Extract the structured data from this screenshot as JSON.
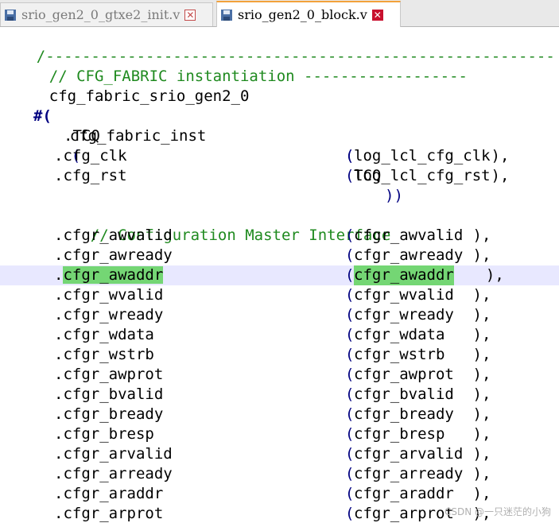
{
  "tabs": [
    {
      "label": "srio_gen2_0_gtxe2_init.v",
      "active": false,
      "icon": "save-file-icon"
    },
    {
      "label": "srio_gen2_0_block.v",
      "active": true,
      "icon": "save-file-icon"
    }
  ],
  "close_glyph": "✕",
  "code": {
    "separator": "/--------------------------------------------------------",
    "comment1": "// CFG_FABRIC instantiation ------------------",
    "module_name": "cfg_fabric_srio_gen2_0",
    "param_hash": "#(",
    "param_name": ".TCQ",
    "param_open": "(",
    "param_value": "TCQ",
    "param_close": "))",
    "inst_name": "cfg_fabric_inst",
    "open_paren": "(",
    "comment2": "// Configuration Master Interface",
    "ports_top": [
      {
        "port": ".cfg_clk",
        "signal": "log_lcl_cfg_clk",
        "end": "),"
      },
      {
        "port": ".cfg_rst",
        "signal": "log_lcl_cfg_rst",
        "end": "),"
      }
    ],
    "ports": [
      {
        "port": "cfgr_awvalid",
        "signal": "cfgr_awvalid ",
        "end": "),"
      },
      {
        "port": "cfgr_awready",
        "signal": "cfgr_awready ",
        "end": "),"
      },
      {
        "port": "cfgr_awaddr",
        "signal": "cfgr_awaddr",
        "end": "  ),"
      },
      {
        "port": "cfgr_wvalid",
        "signal": "cfgr_wvalid  ",
        "end": "),"
      },
      {
        "port": "cfgr_wready",
        "signal": "cfgr_wready  ",
        "end": "),"
      },
      {
        "port": "cfgr_wdata",
        "signal": "cfgr_wdata   ",
        "end": "),"
      },
      {
        "port": "cfgr_wstrb",
        "signal": "cfgr_wstrb   ",
        "end": "),"
      },
      {
        "port": "cfgr_awprot",
        "signal": "cfgr_awprot  ",
        "end": "),"
      },
      {
        "port": "cfgr_bvalid",
        "signal": "cfgr_bvalid  ",
        "end": "),"
      },
      {
        "port": "cfgr_bready",
        "signal": "cfgr_bready  ",
        "end": "),"
      },
      {
        "port": "cfgr_bresp",
        "signal": "cfgr_bresp   ",
        "end": "),"
      },
      {
        "port": "cfgr_arvalid",
        "signal": "cfgr_arvalid ",
        "end": "),"
      },
      {
        "port": "cfgr_arready",
        "signal": "cfgr_arready ",
        "end": "),"
      },
      {
        "port": "cfgr_araddr",
        "signal": "cfgr_araddr  ",
        "end": "),"
      },
      {
        "port": "cfgr_arprot",
        "signal": "cfgr_arprot  ",
        "end": "),"
      }
    ]
  },
  "watermark": "CSDN @一只迷茫的小狗",
  "colors": {
    "comment": "#1f8a1f",
    "paren": "#000080",
    "highlight": "#74d674",
    "current_line": "#e8e8ff",
    "active_tab_accent": "#f2a23b"
  }
}
